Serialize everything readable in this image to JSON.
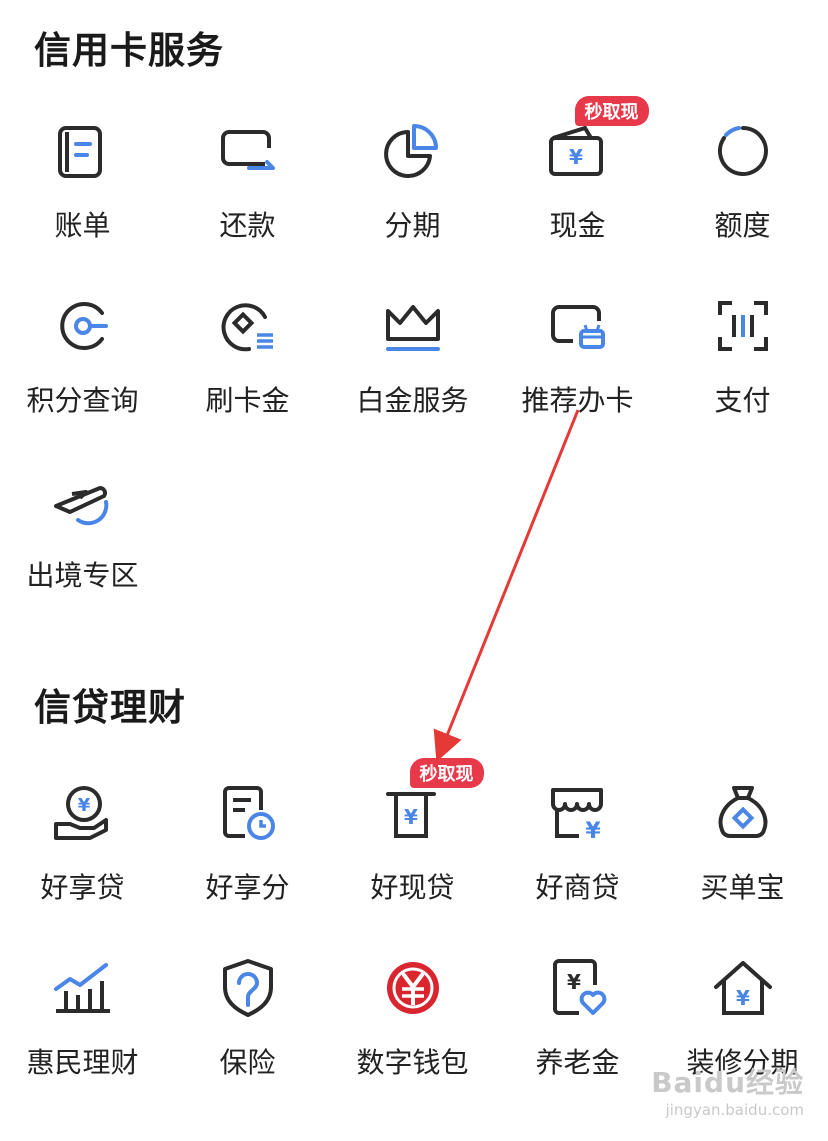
{
  "credit_section": {
    "title": "信用卡服务",
    "items": [
      {
        "label": "账单",
        "icon": "bill-icon"
      },
      {
        "label": "还款",
        "icon": "repay-icon"
      },
      {
        "label": "分期",
        "icon": "pie-chart-icon"
      },
      {
        "label": "现金",
        "icon": "cash-icon",
        "badge": "秒取现"
      },
      {
        "label": "额度",
        "icon": "quota-ring-icon"
      },
      {
        "label": "积分查询",
        "icon": "points-icon"
      },
      {
        "label": "刷卡金",
        "icon": "card-gold-icon"
      },
      {
        "label": "白金服务",
        "icon": "crown-icon"
      },
      {
        "label": "推荐办卡",
        "icon": "recommend-card-icon"
      },
      {
        "label": "支付",
        "icon": "scan-pay-icon"
      },
      {
        "label": "出境专区",
        "icon": "airplane-icon"
      }
    ]
  },
  "loan_section": {
    "title": "信贷理财",
    "items": [
      {
        "label": "好享贷",
        "icon": "coin-hand-icon"
      },
      {
        "label": "好享分",
        "icon": "doc-clock-icon"
      },
      {
        "label": "好现贷",
        "icon": "cash-loan-icon",
        "badge": "秒取现"
      },
      {
        "label": "好商贷",
        "icon": "shop-loan-icon"
      },
      {
        "label": "买单宝",
        "icon": "money-bag-icon"
      },
      {
        "label": "惠民理财",
        "icon": "growth-chart-icon"
      },
      {
        "label": "保险",
        "icon": "shield-icon"
      },
      {
        "label": "数字钱包",
        "icon": "digital-yuan-icon"
      },
      {
        "label": "养老金",
        "icon": "pension-icon"
      },
      {
        "label": "装修分期",
        "icon": "house-yuan-icon"
      }
    ]
  },
  "watermark": {
    "brand": "Baidu经验",
    "url": "jingyan.baidu.com"
  },
  "colors": {
    "accent": "#4a86e8",
    "stroke": "#2b2b2b",
    "badge": "#e8394a",
    "annotation_arrow": "#e53935"
  }
}
